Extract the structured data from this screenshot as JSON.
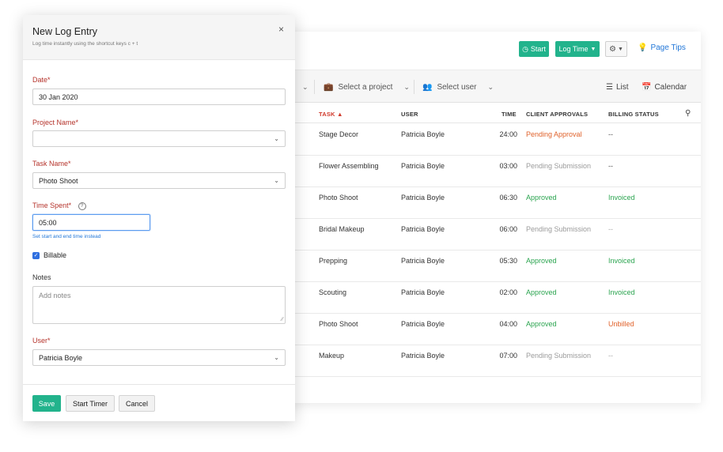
{
  "app": {
    "buttons": {
      "start": "Start",
      "log_time": "Log Time",
      "page_tips": "Page Tips"
    },
    "filters": {
      "project": "Select a project",
      "user": "Select user"
    },
    "views": {
      "list": "List",
      "calendar": "Calendar"
    },
    "columns": {
      "task": "TASK",
      "user": "USER",
      "time": "TIME",
      "client_approvals": "CLIENT APPROVALS",
      "billing_status": "BILLING STATUS"
    },
    "rows": [
      {
        "task": "Stage Decor",
        "user": "Patricia Boyle",
        "time": "24:00",
        "approval": "Pending Approval",
        "approval_kind": "pending",
        "billing": "--",
        "billing_kind": "dash"
      },
      {
        "task": "Flower Assembling",
        "user": "Patricia Boyle",
        "time": "03:00",
        "approval": "Pending Submission",
        "approval_kind": "sub",
        "billing": "--",
        "billing_kind": "dash"
      },
      {
        "task": "Photo Shoot",
        "user": "Patricia Boyle",
        "time": "06:30",
        "approval": "Approved",
        "approval_kind": "appr",
        "billing": "Invoiced",
        "billing_kind": "inv"
      },
      {
        "task": "Bridal Makeup",
        "user": "Patricia Boyle",
        "time": "06:00",
        "approval": "Pending Submission",
        "approval_kind": "sub",
        "billing": "--",
        "billing_kind": "dash-grey"
      },
      {
        "task": "Prepping",
        "user": "Patricia Boyle",
        "time": "05:30",
        "approval": "Approved",
        "approval_kind": "appr",
        "billing": "Invoiced",
        "billing_kind": "inv"
      },
      {
        "task": "Scouting",
        "user": "Patricia Boyle",
        "time": "02:00",
        "approval": "Approved",
        "approval_kind": "appr",
        "billing": "Invoiced",
        "billing_kind": "inv"
      },
      {
        "task": "Photo Shoot",
        "user": "Patricia Boyle",
        "time": "04:00",
        "approval": "Approved",
        "approval_kind": "appr",
        "billing": "Unbilled",
        "billing_kind": "unb"
      },
      {
        "task": "Makeup",
        "user": "Patricia Boyle",
        "time": "07:00",
        "approval": "Pending Submission",
        "approval_kind": "sub",
        "billing": "--",
        "billing_kind": "dash-grey"
      }
    ]
  },
  "modal": {
    "title": "New Log Entry",
    "subtitle": "Log time instantly using the shortcut keys c + t",
    "date_label": "Date*",
    "date_value": "30 Jan 2020",
    "project_label": "Project Name*",
    "project_value": "",
    "task_label": "Task Name*",
    "task_value": "Photo Shoot",
    "time_label": "Time Spent*",
    "time_value": "05:00",
    "time_link": "Set start and end time instead",
    "billable_label": "Billable",
    "billable_checked": true,
    "notes_label": "Notes",
    "notes_placeholder": "Add notes",
    "user_label": "User*",
    "user_value": "Patricia Boyle",
    "save": "Save",
    "start_timer": "Start Timer",
    "cancel": "Cancel"
  },
  "colors": {
    "accent_green": "#22b38c",
    "required_label": "#b5332b",
    "link_blue": "#2277d8",
    "status_orange": "#e0622b",
    "status_green": "#2aa44f"
  }
}
